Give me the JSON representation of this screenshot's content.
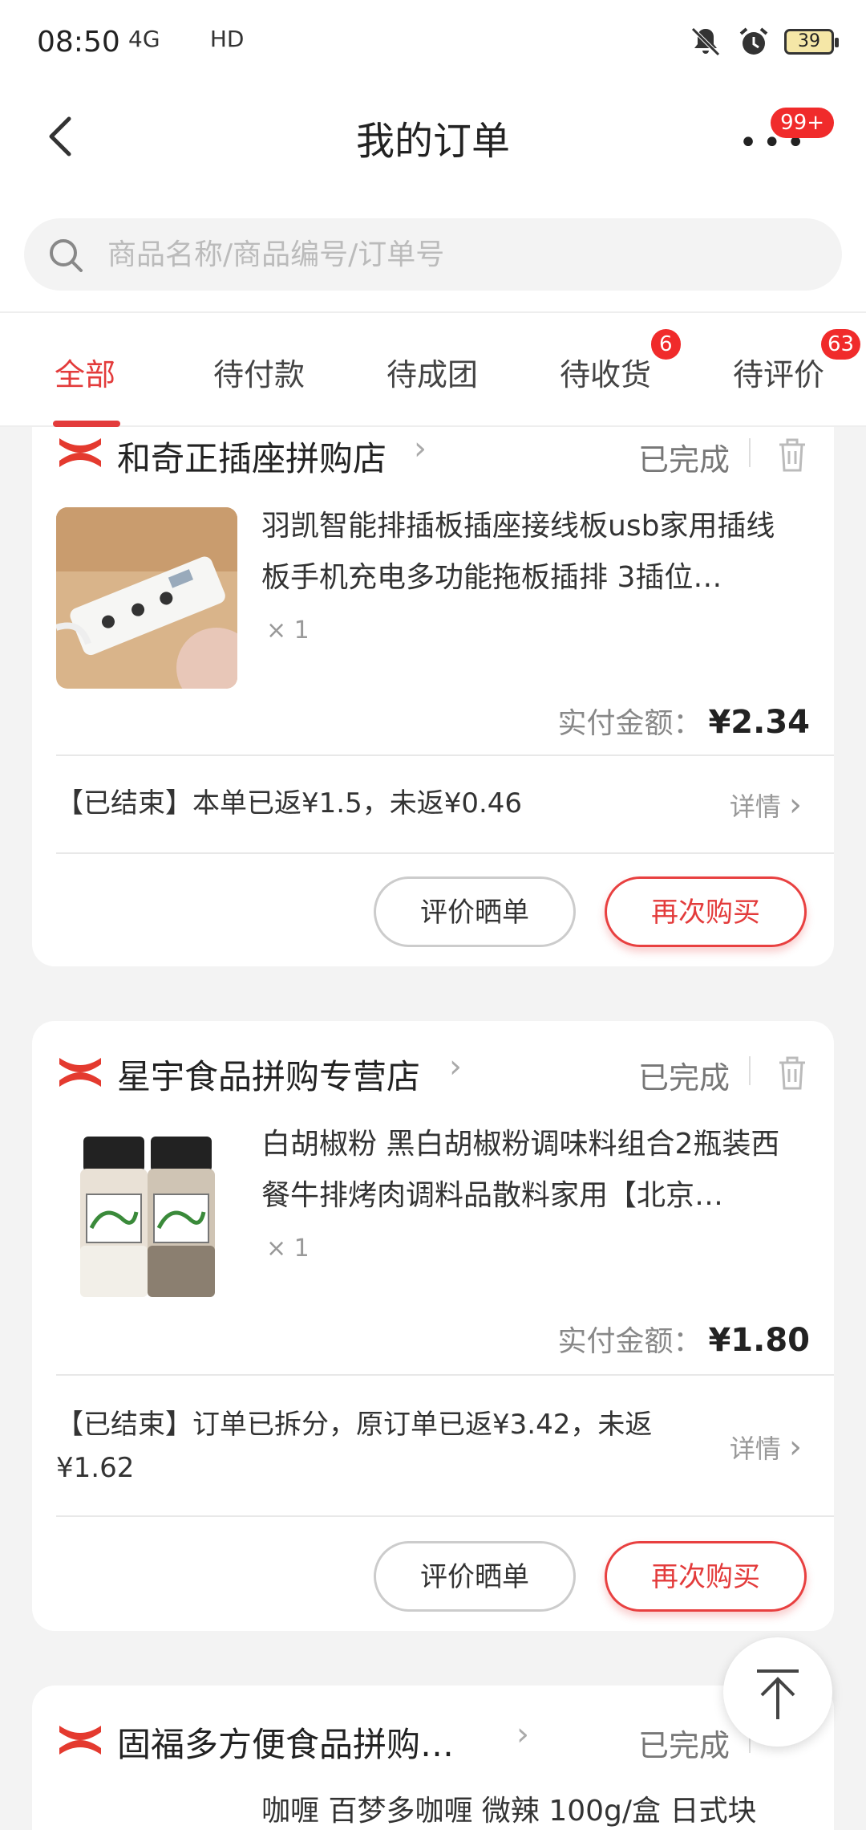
{
  "statusbar": {
    "time": "08:50",
    "network": "4G       HD",
    "battery": "39"
  },
  "header": {
    "title": "我的订单",
    "more_badge": "99+"
  },
  "search": {
    "placeholder": "商品名称/商品编号/订单号"
  },
  "tabs": [
    {
      "label": "全部",
      "active": true
    },
    {
      "label": "待付款"
    },
    {
      "label": "待成团"
    },
    {
      "label": "待收货",
      "badge": "6"
    },
    {
      "label": "待评价",
      "badge": "63"
    }
  ],
  "orders": [
    {
      "shop": "和奇正插座拼购店",
      "status": "已完成",
      "product_title": "羽凯智能排插板插座接线板usb家用插线板手机充电多功能拖板插排 3插位…",
      "qty": "× 1",
      "paid_label": "实付金额：",
      "paid_amount": "¥2.34",
      "rebate": "【已结束】本单已返¥1.5，未返¥0.46",
      "detail": "详情",
      "btn_review": "评价晒单",
      "btn_rebuy": "再次购买"
    },
    {
      "shop": "星宇食品拼购专营店",
      "status": "已完成",
      "product_title": "白胡椒粉 黑白胡椒粉调味料组合2瓶装西餐牛排烤肉调料品散料家用【北京…",
      "qty": "× 1",
      "paid_label": "实付金额：",
      "paid_amount": "¥1.80",
      "rebate": "【已结束】订单已拆分，原订单已返¥3.42，未返¥1.62",
      "detail": "详情",
      "btn_review": "评价晒单",
      "btn_rebuy": "再次购买"
    },
    {
      "shop": "固福多方便食品拼购…",
      "status": "已完成",
      "product_title": "咖喱 百梦多咖喱 微辣 100g/盒 日式块"
    }
  ],
  "colors": {
    "accent": "#e33b3b",
    "badge": "#f02b2b"
  }
}
